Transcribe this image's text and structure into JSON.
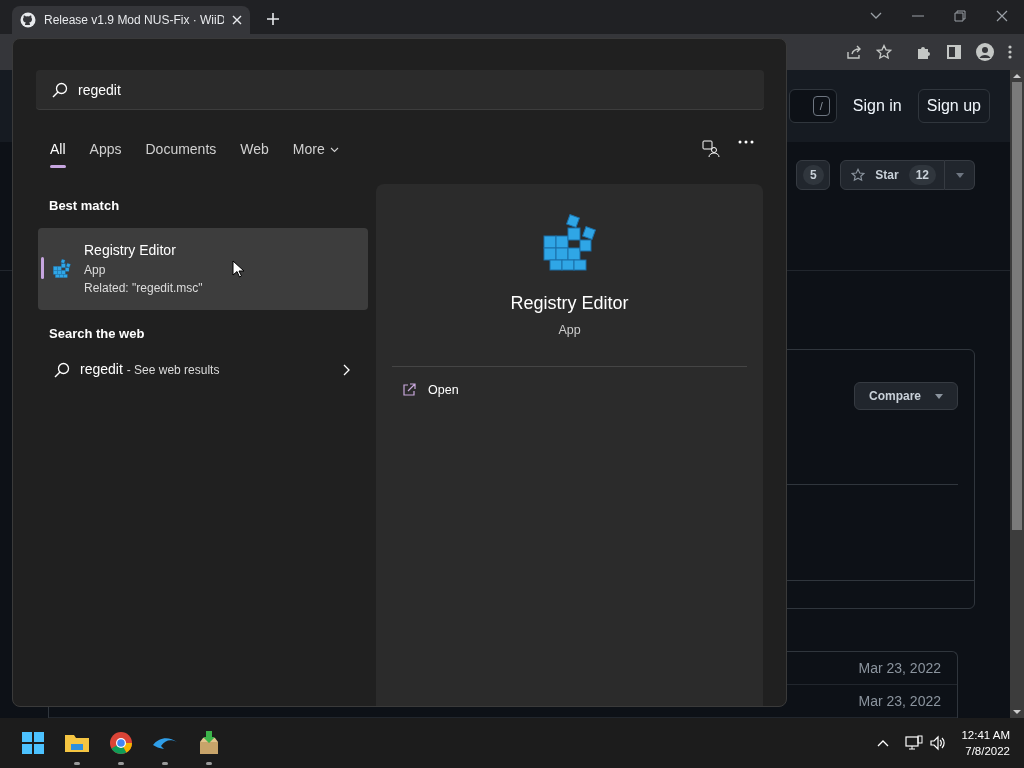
{
  "browser": {
    "tab_title": "Release v1.9 Mod NUS-Fix · WiiD"
  },
  "github": {
    "shortcut_key": "/",
    "sign_in": "Sign in",
    "sign_up": "Sign up",
    "fork_count": "5",
    "star": {
      "label": "Star",
      "count": "12"
    },
    "compare": "Compare",
    "dates": [
      "Mar 23, 2022",
      "Mar 23, 2022"
    ]
  },
  "search": {
    "query": "regedit",
    "tabs": [
      {
        "label": "All",
        "selected": true,
        "kind": "plain"
      },
      {
        "label": "Apps",
        "selected": false,
        "kind": "plain"
      },
      {
        "label": "Documents",
        "selected": false,
        "kind": "plain"
      },
      {
        "label": "Web",
        "selected": false,
        "kind": "plain"
      },
      {
        "label": "More",
        "selected": false,
        "kind": "menu"
      }
    ],
    "best_match": {
      "heading": "Best match",
      "name": "Registry Editor",
      "type": "App",
      "related": "Related: \"regedit.msc\"",
      "selected": true
    },
    "web": {
      "heading": "Search the web",
      "query": "regedit",
      "suffix": "- See web results"
    },
    "preview": {
      "name": "Registry Editor",
      "type": "App",
      "actions": [
        "Open"
      ]
    }
  },
  "taskbar": {
    "time": "12:41 AM",
    "date": "7/8/2022"
  }
}
